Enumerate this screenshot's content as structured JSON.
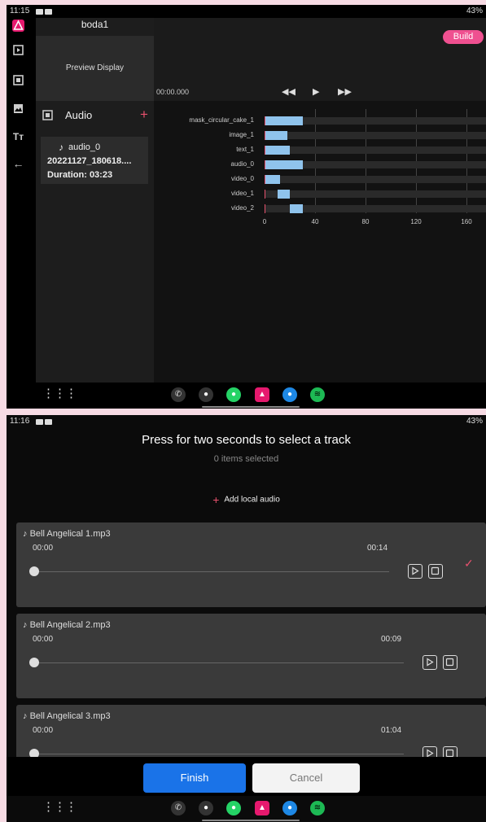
{
  "top": {
    "status": {
      "time": "11:15",
      "right": "43%"
    },
    "project_name": "boda1",
    "preview_label": "Preview Display",
    "build_label": "Build",
    "timecode": "00:00.000",
    "audio_section": {
      "title": "Audio",
      "add_symbol": "+"
    },
    "audio_item": {
      "name": "audio_0",
      "file": "20221127_180618....",
      "duration": "Duration: 03:23"
    },
    "sidebar_icons": [
      "app-logo-icon",
      "video-icon",
      "image-icon",
      "gallery-icon",
      "text-icon",
      "back-icon"
    ],
    "playback": {
      "rewind": "◀◀",
      "play": "▶",
      "forward": "▶▶"
    }
  },
  "chart_data": {
    "type": "bar",
    "orientation": "horizontal",
    "categories": [
      "mask_circular_cake_1",
      "image_1",
      "text_1",
      "audio_0",
      "video_0",
      "video_1",
      "video_2"
    ],
    "series": [
      {
        "start": [
          0,
          0,
          0,
          0,
          0,
          10,
          20
        ],
        "end": [
          30,
          18,
          20,
          30,
          12,
          20,
          30
        ]
      }
    ],
    "xticks": [
      "0",
      "40",
      "80",
      "120",
      "160"
    ],
    "xlim": [
      0,
      170
    ]
  },
  "bottom": {
    "status": {
      "time": "11:16",
      "right": "43%"
    },
    "title": "Press for two seconds to select a track",
    "subtitle": "0 items selected",
    "add_local": "Add local audio",
    "tracks": [
      {
        "name": "Bell Angelical 1.mp3",
        "start": "00:00",
        "end": "00:14",
        "selected": true
      },
      {
        "name": "Bell Angelical 2.mp3",
        "start": "00:00",
        "end": "00:09",
        "selected": false
      },
      {
        "name": "Bell Angelical 3.mp3",
        "start": "00:00",
        "end": "01:04",
        "selected": false
      }
    ],
    "finish_label": "Finish",
    "cancel_label": "Cancel"
  },
  "colors": {
    "accent": "#e8516e",
    "build": "#ef5090",
    "bar": "#8fc3ec",
    "finish": "#1a73e8"
  }
}
